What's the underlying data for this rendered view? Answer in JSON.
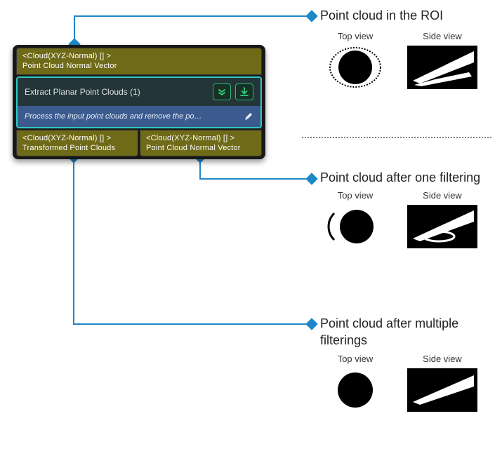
{
  "node": {
    "input_port": {
      "type_label": "<Cloud(XYZ-Normal) [] >",
      "name": "Point Cloud Normal Vector"
    },
    "title": "Extract Planar Point Clouds (1)",
    "description": "Process the input point clouds and remove the po…",
    "icons": {
      "expand": "expand-down",
      "download": "download"
    },
    "output_ports": {
      "left": {
        "type_label": "<Cloud(XYZ-Normal) [] >",
        "name": "Transformed Point Clouds"
      },
      "right": {
        "type_label": "<Cloud(XYZ-Normal) [] >",
        "name": "Point Cloud Normal Vector"
      }
    }
  },
  "callouts": {
    "c1": {
      "title": "Point cloud in the ROI",
      "top_label": "Top view",
      "side_label": "Side view"
    },
    "c2": {
      "title": "Point cloud after one filtering",
      "top_label": "Top view",
      "side_label": "Side view"
    },
    "c3": {
      "title": "Point cloud after multiple filterings",
      "top_label": "Top view",
      "side_label": "Side view"
    }
  },
  "colors": {
    "connector": "#1d87c8",
    "port_bg": "#6e6a18",
    "node_border": "#2dc9c3",
    "desc_bg": "#3b5b8f"
  }
}
